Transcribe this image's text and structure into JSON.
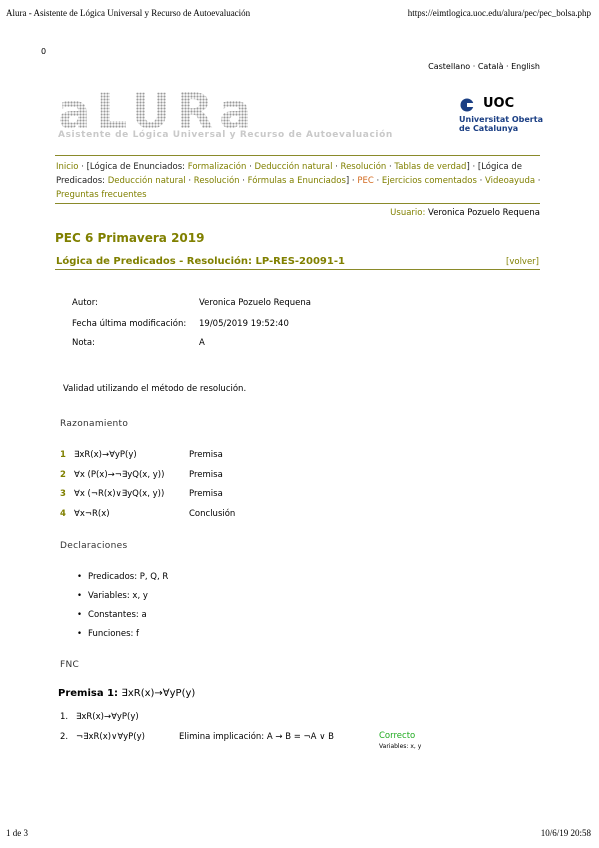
{
  "print_header": {
    "title": "Alura - Asistente de Lógica Universal y Recurso de Autoevaluación",
    "url": "https://eimtlogica.uoc.edu/alura/pec/pec_bolsa.php"
  },
  "zero_label": "0",
  "languages": [
    "Castellano",
    "Català",
    "English"
  ],
  "language_separator": " · ",
  "logo": {
    "text": "aLURa",
    "subtitle": "Asistente de Lógica Universal y Recurso de Autoevaluación"
  },
  "uoc": {
    "name": "UOC",
    "line1": "Universitat Oberta",
    "line2": "de Catalunya"
  },
  "nav": {
    "inicio": "Inicio",
    "sep": "·",
    "logica_enunciados": "[Lógica de Enunciados:",
    "formalizacion": "Formalización",
    "deduccion_natural": "Deducción natural",
    "resolucion": "Resolución",
    "tablas": "Tablas de verdad",
    "close1": "]",
    "logica_predicados": "[Lógica de Predicados:",
    "deduccion_natural2": "Deducción natural",
    "resolucion2": "Resolución",
    "formulas": "Fórmulas a Enunciados",
    "close2": "]",
    "pec": "PEC",
    "ejercicios": "Ejercicios comentados",
    "videoayuda": "Videoayuda",
    "preguntas": "Preguntas frecuentes"
  },
  "user": {
    "label": "Usuario:",
    "name": "Veronica Pozuelo Requena"
  },
  "pec_title": "PEC 6 Primavera 2019",
  "section_title": "Lógica de Predicados - Resolución: LP-RES-20091-1",
  "volver": "[volver]",
  "meta": {
    "autor_label": "Autor:",
    "autor_value": "Veronica Pozuelo Requena",
    "fecha_label": "Fecha última modificación:",
    "fecha_value": "19/05/2019 19:52:40",
    "nota_label": "Nota:",
    "nota_value": "A"
  },
  "instruction": "Validad utilizando el método de resolución.",
  "razonamiento": {
    "heading": "Razonamiento",
    "rows": [
      {
        "n": "1",
        "formula": "∃xR(x)→∀yP(y)",
        "just": "Premisa"
      },
      {
        "n": "2",
        "formula": "∀x (P(x)→¬∃yQ(x, y))",
        "just": "Premisa"
      },
      {
        "n": "3",
        "formula": "∀x (¬R(x)∨∃yQ(x, y))",
        "just": "Premisa"
      },
      {
        "n": "4",
        "formula": "∀x¬R(x)",
        "just": "Conclusión"
      }
    ]
  },
  "declaraciones": {
    "heading": "Declaraciones",
    "items": [
      "Predicados: P, Q, R",
      "Variables: x, y",
      "Constantes: a",
      "Funciones: f"
    ]
  },
  "fnc": {
    "heading": "FNC",
    "premisa_label": "Premisa 1:",
    "premisa_formula": "∃xR(x)→∀yP(y)",
    "steps": [
      {
        "n": "1.",
        "formula": "∃xR(x)→∀yP(y)"
      },
      {
        "n": "2.",
        "formula": "¬∃xR(x)∨∀yP(y)",
        "rule": "Elimina implicación: A → B = ¬A ∨ B",
        "status": "Correcto",
        "vars": "Variables: x, y"
      }
    ]
  },
  "footer": {
    "page": "1 de 3",
    "date": "10/6/19 20:58"
  }
}
